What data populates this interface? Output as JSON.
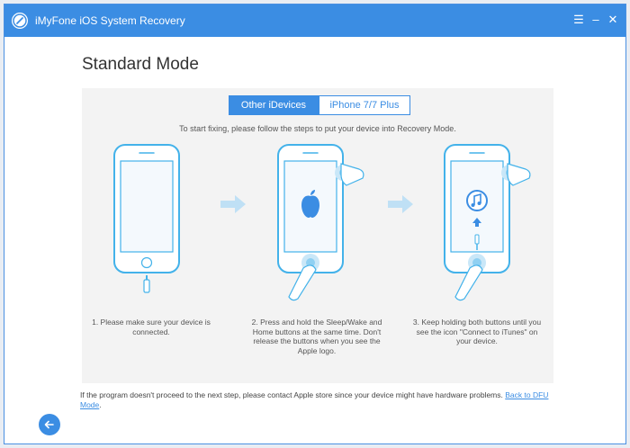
{
  "window": {
    "title": "iMyFone iOS System Recovery",
    "controls": [
      "menu-icon",
      "minimize-icon",
      "close-icon"
    ]
  },
  "page": {
    "title": "Standard Mode"
  },
  "tabs": [
    {
      "label": "Other iDevices",
      "active": true
    },
    {
      "label": "iPhone 7/7 Plus",
      "active": false
    }
  ],
  "instruction": "To start fixing, please follow the steps to put your device into Recovery Mode.",
  "steps": [
    {
      "text": "1. Please make sure your device is connected.",
      "icon": "phone-cable-icon"
    },
    {
      "text": "2. Press and hold the Sleep/Wake and Home buttons at the same time. Don't release the buttons when you see the Apple logo.",
      "icon": "apple-logo-icon"
    },
    {
      "text": "3. Keep holding both buttons until you see the icon \"Connect to iTunes\" on your device.",
      "icon": "itunes-icon"
    }
  ],
  "footer": {
    "note": "If the program doesn't proceed to the next step, please contact Apple store since your device might have hardware problems.",
    "link": "Back to DFU Mode"
  },
  "colors": {
    "accent": "#3b8de3",
    "phone_stroke": "#43b2ea",
    "panel_bg": "#f3f3f3"
  }
}
